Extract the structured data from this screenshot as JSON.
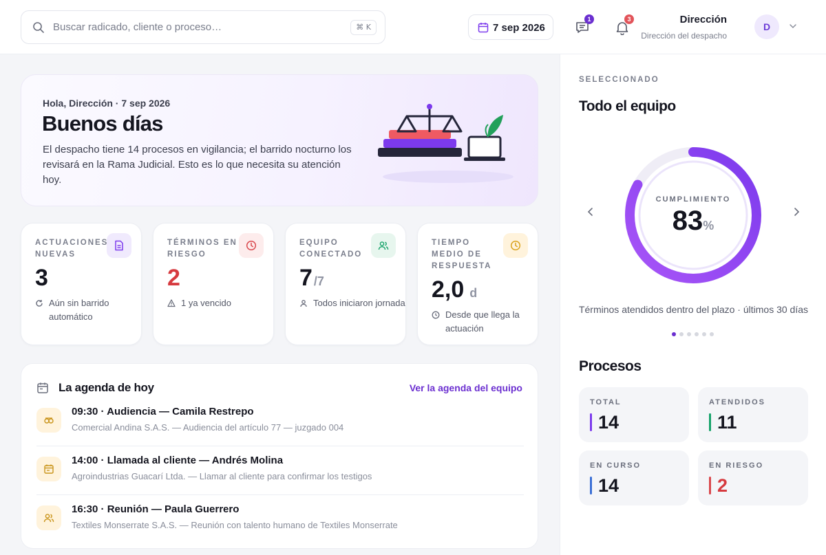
{
  "topbar": {
    "search_placeholder": "Buscar radicado, cliente o proceso…",
    "search_shortcut": "⌘ K",
    "date": "7 sep 2026",
    "messages_badge": "1",
    "notifications_badge": "3",
    "user_name": "Dirección",
    "user_role": "Dirección del despacho",
    "avatar_initial": "D"
  },
  "hero": {
    "greeting": "Hola, Dirección · 7 sep 2026",
    "title": "Buenos días",
    "description": "El despacho tiene 14 procesos en vigilancia; el barrido nocturno los revisará en la Rama Judicial. Esto es lo que necesita su atención hoy."
  },
  "stats": [
    {
      "label": "Actuaciones nuevas",
      "value": "3",
      "suffix": "",
      "note": "Aún sin barrido automático",
      "icon": "document-icon"
    },
    {
      "label": "Términos en riesgo",
      "value": "2",
      "suffix": "",
      "note": "1 ya vencido",
      "icon": "clock-icon"
    },
    {
      "label": "Equipo conectado",
      "value": "7",
      "suffix": "/7",
      "note": "Todos iniciaron jornada",
      "icon": "users-icon"
    },
    {
      "label": "Tiempo medio de respuesta",
      "value": "2,0",
      "suffix": "d",
      "note": "Desde que llega la actuación",
      "icon": "clock-icon"
    }
  ],
  "agenda": {
    "title": "La agenda de hoy",
    "link": "Ver la agenda del equipo",
    "items": [
      {
        "heading": "09:30 · Audiencia — Camila Restrepo",
        "sub": "Comercial Andina S.A.S. — Audiencia del artículo 77 — juzgado 004",
        "icon": "scales-icon"
      },
      {
        "heading": "14:00 · Llamada al cliente — Andrés Molina",
        "sub": "Agroindustrias Guacarí Ltda. — Llamar al cliente para confirmar los testigos",
        "icon": "calendar-icon"
      },
      {
        "heading": "16:30 · Reunión — Paula Guerrero",
        "sub": "Textiles Monserrate S.A.S. — Reunión con talento humano de Textiles Monserrate",
        "icon": "users-icon"
      }
    ]
  },
  "panel": {
    "selected_label": "SELECCIONADO",
    "title": "Todo el equipo",
    "metric_label": "CUMPLIMIENTO",
    "metric_value": "83",
    "metric_unit": "%",
    "metric_fraction": 0.83,
    "caption": "Términos atendidos dentro del plazo · últimos 30 días",
    "carousel_pages": 6,
    "carousel_active": 1,
    "processes_title": "Procesos",
    "processes": [
      {
        "label": "TOTAL",
        "value": "14",
        "color": "#7c3aed"
      },
      {
        "label": "ATENDIDOS",
        "value": "11",
        "color": "#16a36a"
      },
      {
        "label": "EN CURSO",
        "value": "14",
        "color": "#3b6fd6"
      },
      {
        "label": "EN RIESGO",
        "value": "2",
        "color": "#d9484d"
      }
    ]
  },
  "colors": {
    "accent": "#6b2fd0",
    "danger": "#d63a3f"
  }
}
